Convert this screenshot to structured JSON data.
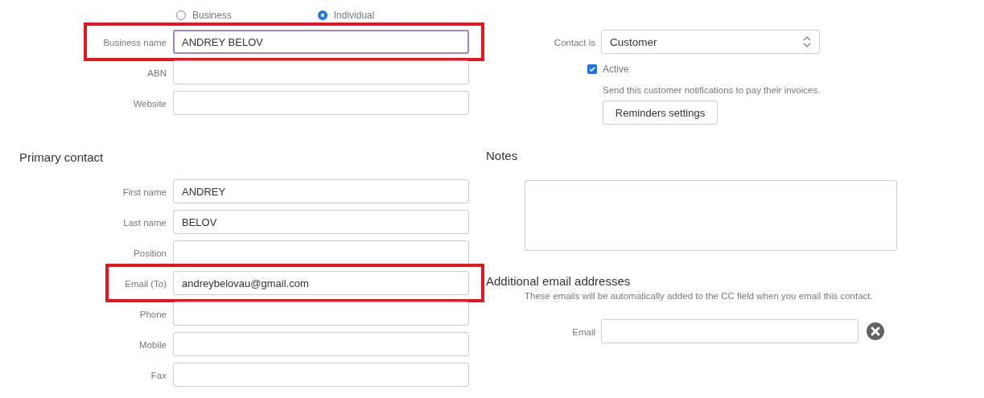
{
  "entity_type": [
    {
      "label": "Business",
      "selected": false
    },
    {
      "label": "Individual",
      "selected": true
    }
  ],
  "business_fields": [
    {
      "label": "Business name",
      "value": "ANDREY BELOV",
      "focused": true,
      "highlighted": true
    },
    {
      "label": "ABN",
      "focused": false,
      "highlighted": false
    },
    {
      "label": "Website",
      "focused": false,
      "highlighted": false
    }
  ],
  "primary_contact": {
    "title": "Primary contact",
    "fields": [
      {
        "label": "First name",
        "value": "ANDREY",
        "highlighted": false
      },
      {
        "label": "Last name",
        "value": "BELOV",
        "highlighted": false
      },
      {
        "label": "Position",
        "highlighted": false
      },
      {
        "label": "Email (To)",
        "value": "andreybelovau@gmail.com",
        "highlighted": true
      },
      {
        "label": "Phone",
        "highlighted": false
      },
      {
        "label": "Mobile",
        "highlighted": false
      },
      {
        "label": "Fax",
        "highlighted": false
      }
    ]
  },
  "contact_type": {
    "label": "Contact is",
    "value": "Customer"
  },
  "active": {
    "label": "Active",
    "checked": true
  },
  "reminders": {
    "description": "Send this customer notifications to pay their invoices.",
    "button": "Reminders settings"
  },
  "notes": {
    "title": "Notes"
  },
  "additional_emails": {
    "title": "Additional email addresses",
    "description": "These emails will be automatically added to the CC field when you email this contact.",
    "fields": [
      {
        "label": "Email"
      }
    ]
  }
}
